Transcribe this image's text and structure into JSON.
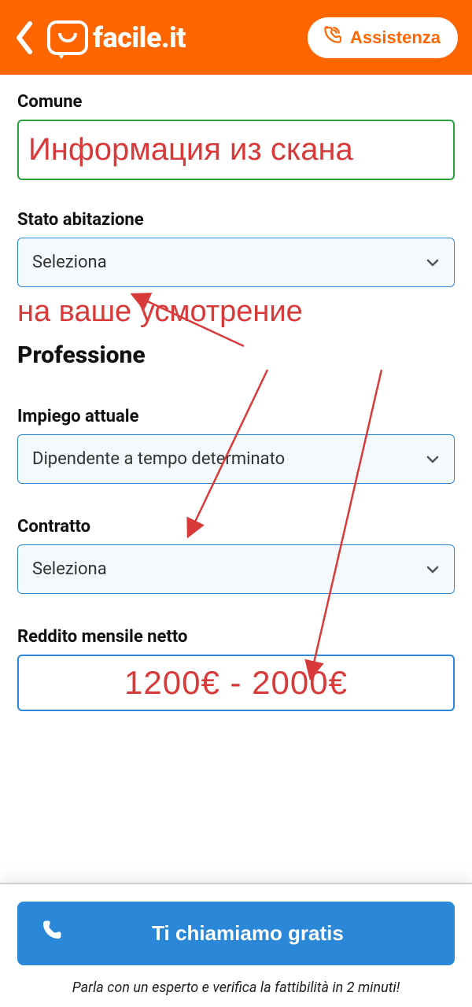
{
  "header": {
    "logo_text": "facile.it",
    "assist_label": "Assistenza"
  },
  "form": {
    "comune": {
      "label": "Comune",
      "value": "Информация из скана"
    },
    "stato_abitazione": {
      "label": "Stato abitazione",
      "value": "Seleziona"
    },
    "annotation_discretion": "на ваше усмотрение",
    "section_professione": "Professione",
    "impiego": {
      "label": "Impiego attuale",
      "value": "Dipendente a tempo determinato"
    },
    "contratto": {
      "label": "Contratto",
      "value": "Seleziona"
    },
    "reddito": {
      "label": "Reddito mensile netto",
      "value": "1200€ - 2000€"
    }
  },
  "footer": {
    "call_label": "Ti chiamiamo gratis",
    "note": "Parla con un esperto e verifica la fattibilità in 2 minuti!"
  }
}
